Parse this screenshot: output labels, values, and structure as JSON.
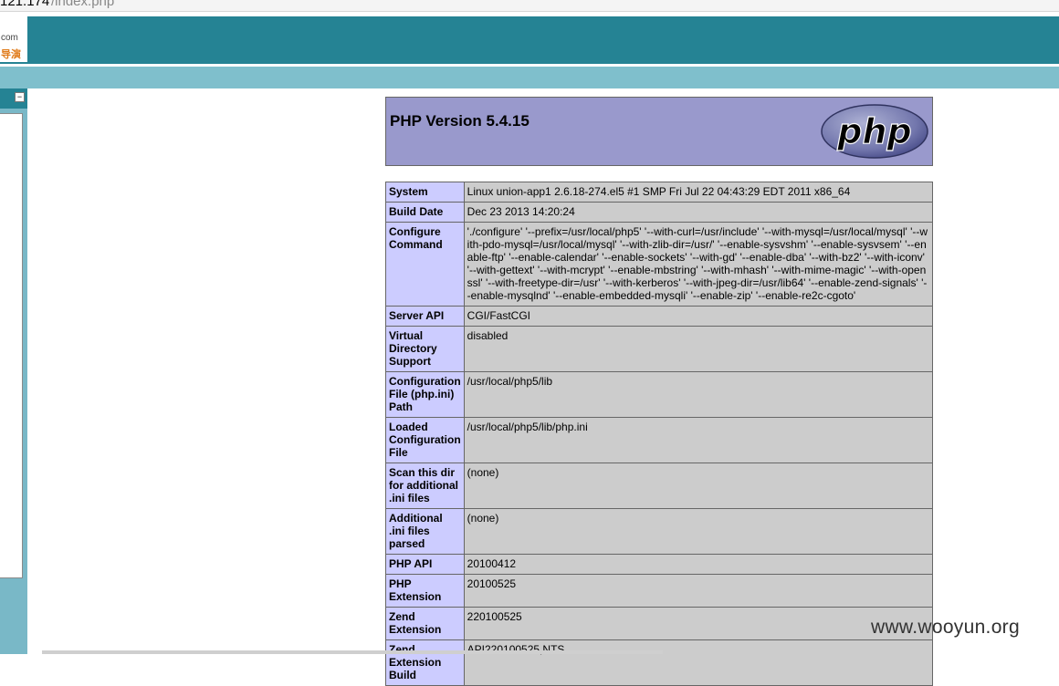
{
  "address_bar": {
    "host": "121.174",
    "path": "/index.php"
  },
  "logo": {
    "line1": "com",
    "line2": "导演"
  },
  "php": {
    "title": "PHP Version 5.4.15",
    "logo_text": "php"
  },
  "info_rows": [
    {
      "label": "System",
      "value": "Linux union-app1 2.6.18-274.el5 #1 SMP Fri Jul 22 04:43:29 EDT 2011 x86_64"
    },
    {
      "label": "Build Date",
      "value": "Dec 23 2013 14:20:24"
    },
    {
      "label": "Configure Command",
      "value": "'./configure' '--prefix=/usr/local/php5' '--with-curl=/usr/include' '--with-mysql=/usr/local/mysql' '--with-pdo-mysql=/usr/local/mysql' '--with-zlib-dir=/usr/' '--enable-sysvshm' '--enable-sysvsem' '--enable-ftp' '--enable-calendar' '--enable-sockets' '--with-gd' '--enable-dba' '--with-bz2' '--with-iconv' '--with-gettext' '--with-mcrypt' '--enable-mbstring' '--with-mhash' '--with-mime-magic' '--with-openssl' '--with-freetype-dir=/usr' '--with-kerberos' '--with-jpeg-dir=/usr/lib64' '--enable-zend-signals' '--enable-mysqlnd' '--enable-embedded-mysqli' '--enable-zip' '--enable-re2c-cgoto'"
    },
    {
      "label": "Server API",
      "value": "CGI/FastCGI"
    },
    {
      "label": "Virtual Directory Support",
      "value": "disabled"
    },
    {
      "label": "Configuration File (php.ini) Path",
      "value": "/usr/local/php5/lib"
    },
    {
      "label": "Loaded Configuration File",
      "value": "/usr/local/php5/lib/php.ini"
    },
    {
      "label": "Scan this dir for additional .ini files",
      "value": "(none)"
    },
    {
      "label": "Additional .ini files parsed",
      "value": "(none)"
    },
    {
      "label": "PHP API",
      "value": "20100412"
    },
    {
      "label": "PHP Extension",
      "value": "20100525"
    },
    {
      "label": "Zend Extension",
      "value": "220100525"
    },
    {
      "label": "Zend Extension Build",
      "value": "API220100525,NTS"
    }
  ],
  "watermark": "www.wooyun.org"
}
